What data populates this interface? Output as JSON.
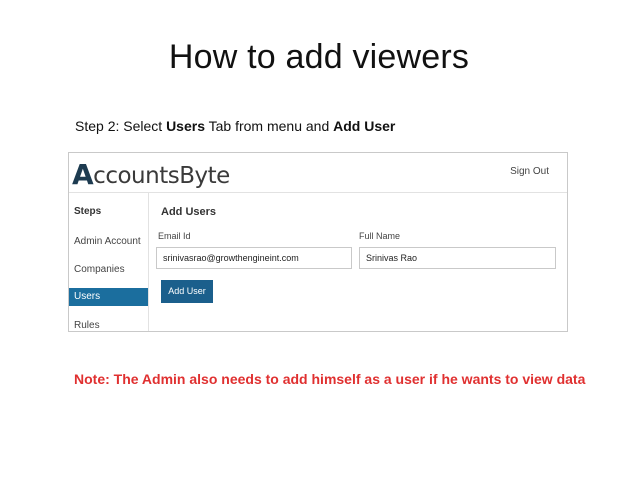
{
  "slide": {
    "title": "How to add viewers",
    "step": {
      "prefix": "Step 2: Select ",
      "bold1": "Users",
      "middle": " Tab from menu and ",
      "bold2": "Add User"
    },
    "note": "Note: The Admin also needs to add himself as a user if he wants to view data"
  },
  "app": {
    "logo": {
      "initial": "A",
      "rest": "ccountsByte"
    },
    "signout_label": "Sign Out",
    "sidebar": {
      "heading": "Steps",
      "items": [
        "Admin Account",
        "Companies",
        "Users",
        "Rules"
      ],
      "active": "Users"
    },
    "form": {
      "title": "Add Users",
      "email": {
        "label": "Email Id",
        "value": "srinivasrao@growthengineint.com"
      },
      "fullname": {
        "label": "Full Name",
        "value": "Srinivas Rao"
      },
      "submit_label": "Add User"
    }
  },
  "colors": {
    "accent": "#1b6e9e",
    "button": "#1b5f8c",
    "note": "#e03030"
  }
}
